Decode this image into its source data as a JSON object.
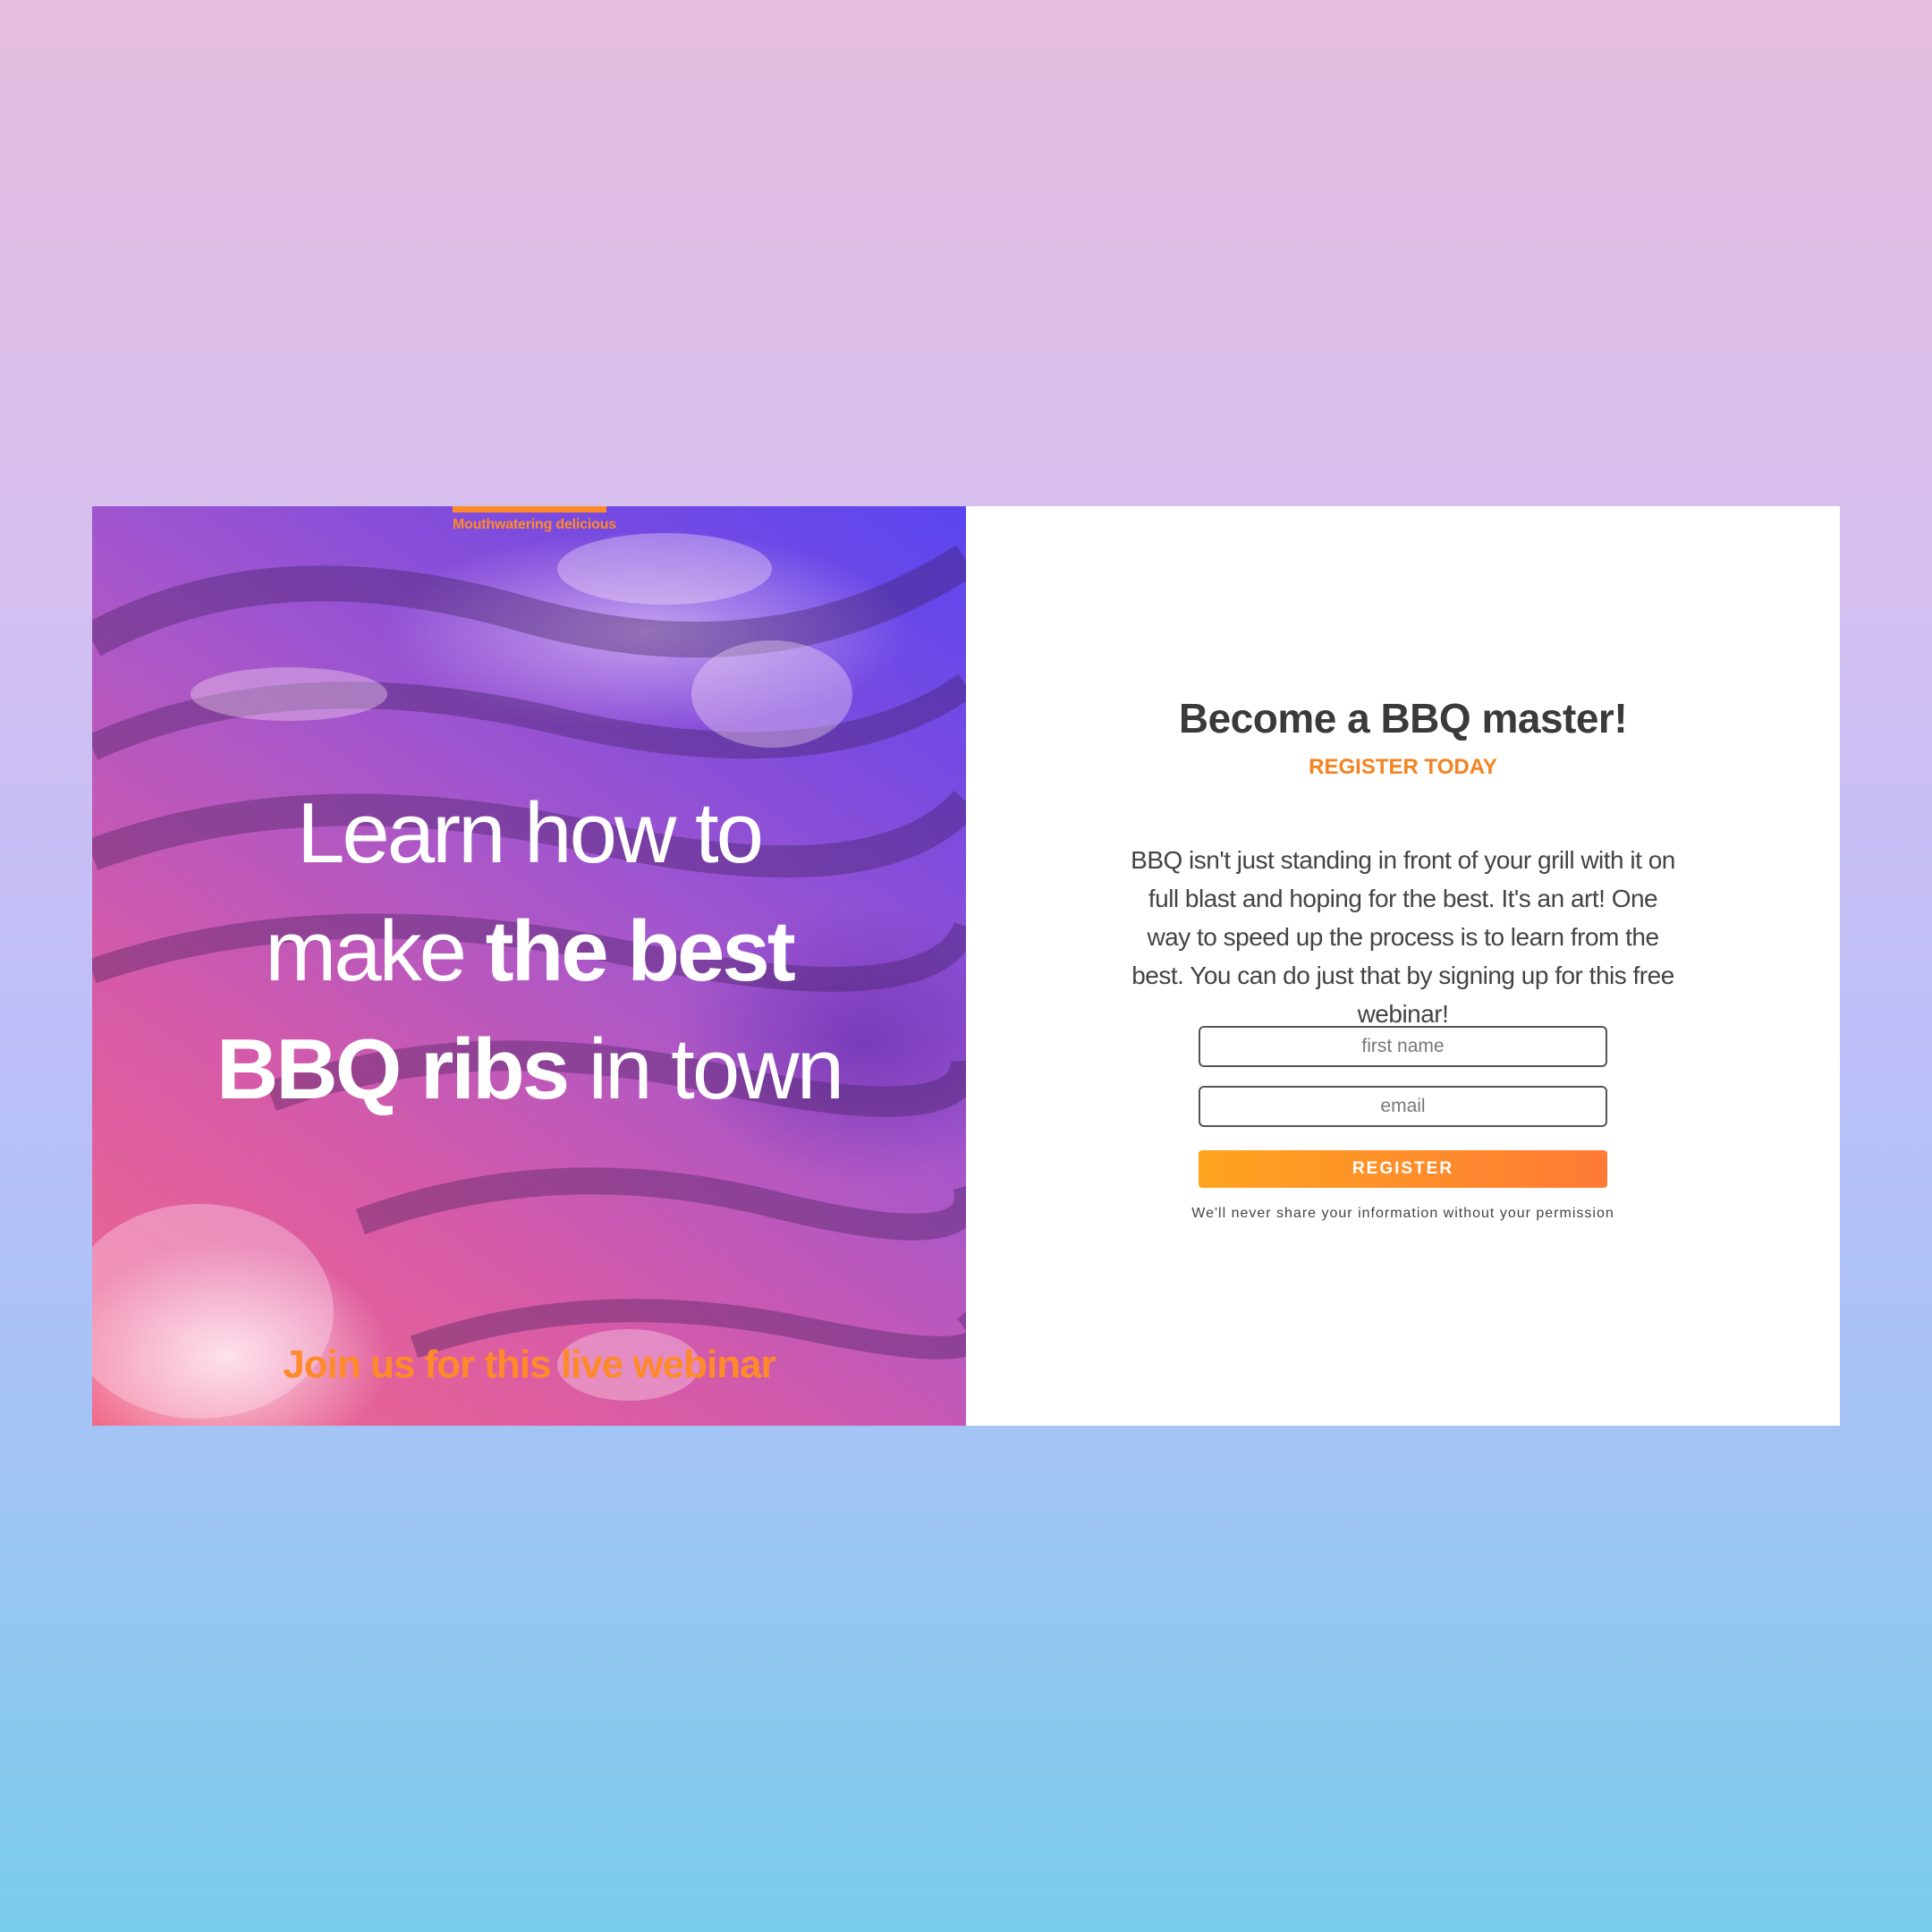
{
  "hero": {
    "tag": "Mouthwatering delicious",
    "headline": {
      "line1": "Learn how to",
      "line2_light": "make ",
      "line2_bold": "the best",
      "line3_bold": "BBQ ribs",
      "line3_light": " in town"
    },
    "join": "Join us for this live webinar"
  },
  "form": {
    "title": "Become a BBQ master!",
    "subtitle": "REGISTER TODAY",
    "description": "BBQ isn't just standing in front of your grill with it on full blast and hoping for the best. It's an art! One way to speed up the process is to learn from the best. You can do just that by signing up for this free webinar!",
    "first_name_placeholder": "first name",
    "email_placeholder": "email",
    "register_label": "REGISTER",
    "privacy": "We'll never share your information without your permission"
  },
  "colors": {
    "accent": "#f4821f",
    "button_start": "#ffa41e",
    "button_end": "#ff7a35",
    "heading": "#3a3a3a"
  }
}
